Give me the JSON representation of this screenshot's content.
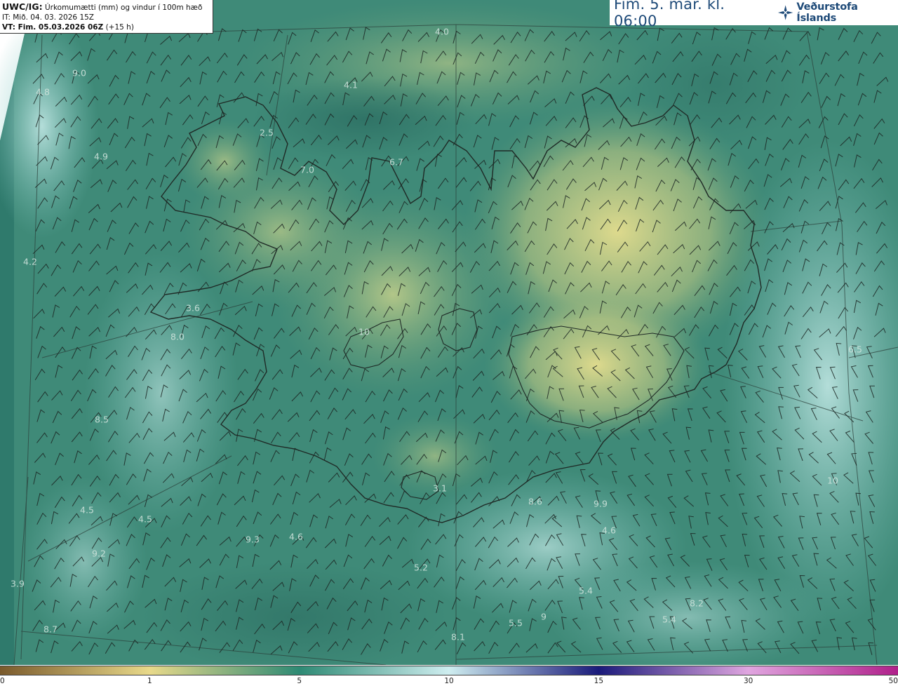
{
  "info": {
    "model": "UWC/IG:",
    "description": "Úrkomumætti (mm) og vindur í 100m hæð",
    "init_time": "IT: Mið. 04. 03. 2026 15Z",
    "valid_prefix": "VT: Fim. 05.03.2026 06Z",
    "valid_suffix": "(+15 h)"
  },
  "header": {
    "title": "Fim. 5. mar. kl. 06:00",
    "brand": "Veðurstofa Íslands",
    "logo_icon": "vedurstofa-logo-icon"
  },
  "colorbar": {
    "ticks": [
      "0",
      "1",
      "5",
      "10",
      "15",
      "30",
      "50"
    ],
    "colors": [
      "#7a5a2c",
      "#e8d98a",
      "#2e8a74",
      "#cfeef0",
      "#1a1a7a",
      "#e0a6e0",
      "#b0208a"
    ]
  },
  "labels": [
    {
      "text": "4.0"
    },
    {
      "text": "4.1"
    },
    {
      "text": "4.8"
    },
    {
      "text": "9.0"
    },
    {
      "text": "2.5"
    },
    {
      "text": "7.0"
    },
    {
      "text": "6.7"
    },
    {
      "text": "4.9"
    },
    {
      "text": "4.2"
    },
    {
      "text": "3.6"
    },
    {
      "text": "8.0"
    },
    {
      "text": "8.5"
    },
    {
      "text": "10"
    },
    {
      "text": "4.5"
    },
    {
      "text": "4.5"
    },
    {
      "text": "4.6"
    },
    {
      "text": "9.3"
    },
    {
      "text": "9.2"
    },
    {
      "text": "3.9"
    },
    {
      "text": "5.2"
    },
    {
      "text": "3.1"
    },
    {
      "text": "4.6"
    },
    {
      "text": "5.4"
    },
    {
      "text": "5.5"
    },
    {
      "text": "5.4"
    },
    {
      "text": "8.1"
    },
    {
      "text": "8.7"
    },
    {
      "text": "6.5"
    },
    {
      "text": "10"
    },
    {
      "text": "9.9"
    },
    {
      "text": "8.6"
    },
    {
      "text": "9"
    },
    {
      "text": "8.2"
    }
  ]
}
